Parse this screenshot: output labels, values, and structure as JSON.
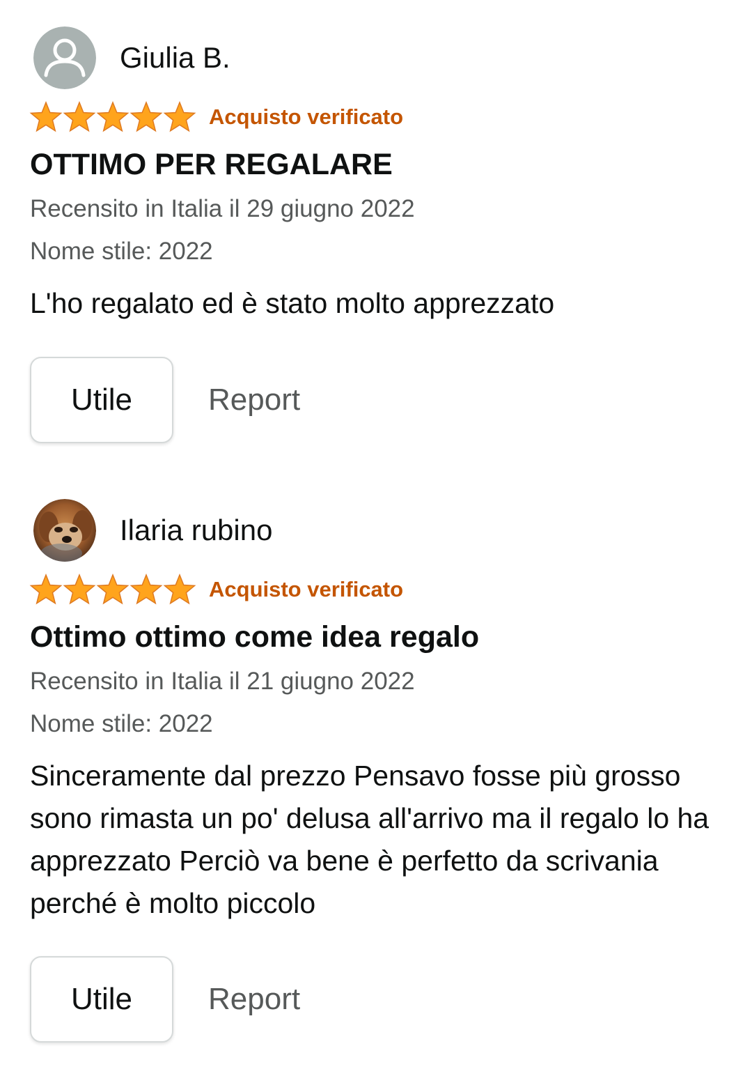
{
  "colors": {
    "star": "#ffa41c",
    "verified": "#c45500",
    "text_primary": "#0f1111",
    "text_secondary": "#565959",
    "button_border": "#d5d9d9"
  },
  "reviews": [
    {
      "author": "Giulia B.",
      "avatar": "default-user-icon",
      "rating": 5,
      "rating_max": 5,
      "verified_label": "Acquisto verificato",
      "title": "OTTIMO PER REGALARE",
      "date": "Recensito in Italia il 29 giugno 2022",
      "style": "Nome stile: 2022",
      "body": "L'ho regalato ed è stato molto apprezzato",
      "helpful_label": "Utile",
      "report_label": "Report"
    },
    {
      "author": "Ilaria rubino",
      "avatar": "dog-photo",
      "rating": 5,
      "rating_max": 5,
      "verified_label": "Acquisto verificato",
      "title": "Ottimo ottimo come idea regalo",
      "date": "Recensito in Italia il 21 giugno 2022",
      "style": "Nome stile: 2022",
      "body": "Sinceramente dal prezzo Pensavo fosse più grosso sono rimasta un po' delusa all'arrivo ma il regalo lo ha apprezzato Perciò va bene è perfetto da scrivania perché è molto piccolo",
      "helpful_label": "Utile",
      "report_label": "Report"
    }
  ]
}
